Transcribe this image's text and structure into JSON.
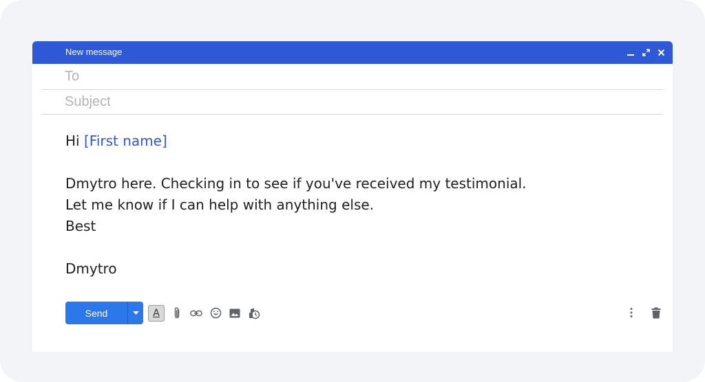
{
  "window": {
    "title": "New message"
  },
  "fields": {
    "to_placeholder": "To",
    "subject_placeholder": "Subject"
  },
  "body": {
    "greeting": "Hi",
    "first_name_token": "[First name]",
    "line1": "Dmytro here. Checking in to see if you've received my testimonial.",
    "line2": "Let me know if I can help with anything else.",
    "line3": "Best",
    "signature": "Dmytro"
  },
  "toolbar": {
    "send_label": "Send",
    "format_letter": "A",
    "icons": [
      "formatting-icon",
      "attach-icon",
      "link-icon",
      "emoji-icon",
      "image-icon",
      "confidential-icon",
      "more-options-icon",
      "trash-icon"
    ]
  },
  "colors": {
    "title_bar": "#2e58d6",
    "send_button": "#2b78ea",
    "token_text": "#2e58d6",
    "frame_background": "#f3f4f8"
  }
}
